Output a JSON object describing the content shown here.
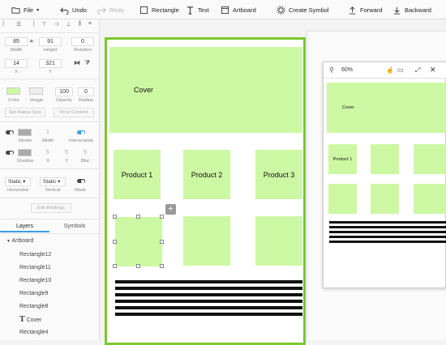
{
  "toolbar": {
    "file": "File",
    "undo": "Undo",
    "redo": "Redo",
    "rectangle": "Rectangle",
    "text": "Text",
    "artboard": "Artboard",
    "create_symbol": "Create Symbol",
    "forward": "Forward",
    "backward": "Backward"
  },
  "props": {
    "width": "85",
    "height": "91",
    "rotation": "0",
    "x": "14",
    "y": "321",
    "width_label": "Width",
    "height_label": "Height",
    "rotation_label": "Rotation",
    "x_label": "X",
    "y_label": "Y",
    "color_label": "Color",
    "image_label": "Image",
    "opacity": "100",
    "opacity_label": "Opacity",
    "radius": "0",
    "radius_label": "Radius",
    "set_native_size": "Set Native Size",
    "fit_to_content": "Fit to Content",
    "stroke_label": "Stroke",
    "stroke_width": "1",
    "stroke_width_label": "Width",
    "interactable_label": "Interactable",
    "shadow_label": "Shadow",
    "shadow_x": "5",
    "shadow_y": "5",
    "shadow_blur": "5",
    "x2_label": "X",
    "y2_label": "Y",
    "blur_label": "Blur",
    "horizontal_value": "Static",
    "horizontal_label": "Horizontal",
    "vertical_value": "Static",
    "vertical_label": "Vertical",
    "mask_label": "Mask",
    "edit_bindings": "Edit Bindings",
    "fill_color": "#cdf8a3"
  },
  "tabs": {
    "layers": "Layers",
    "symbols": "Symbols"
  },
  "layers": {
    "root": "Artboard",
    "items": [
      "Rectangle12",
      "Rectangle11",
      "Rectangle10",
      "Rectangle9",
      "Rectangle8",
      "Cover",
      "Rectangle4"
    ]
  },
  "canvas": {
    "cover": "Cover",
    "products": [
      "Product 1",
      "Product 2",
      "Product 3"
    ]
  },
  "preview": {
    "zoom": "60%",
    "cover": "Cover",
    "product1": "Product 1"
  }
}
